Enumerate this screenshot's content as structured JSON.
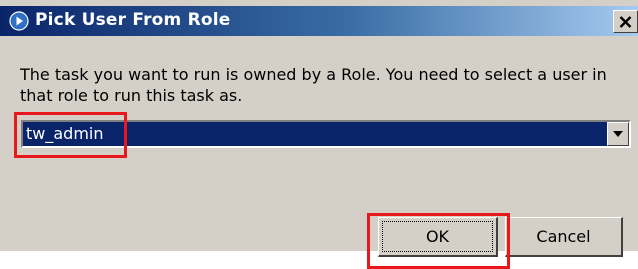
{
  "window": {
    "title": "Pick User From Role",
    "icon": "blue-arrow-icon",
    "close_glyph": "✕"
  },
  "message": "The task you want to run is owned by a Role. You need to select a user in that role to run this task as.",
  "user_select": {
    "selected_value": "tw_admin",
    "arrow_icon": "chevron-down-icon"
  },
  "buttons": {
    "ok_label": "OK",
    "cancel_label": "Cancel"
  },
  "colors": {
    "titlebar_start": "#0a246a",
    "titlebar_end": "#a6caf0",
    "dialog_face": "#d4d0c8",
    "selection": "#0a246a",
    "highlight": "#e8171c"
  }
}
